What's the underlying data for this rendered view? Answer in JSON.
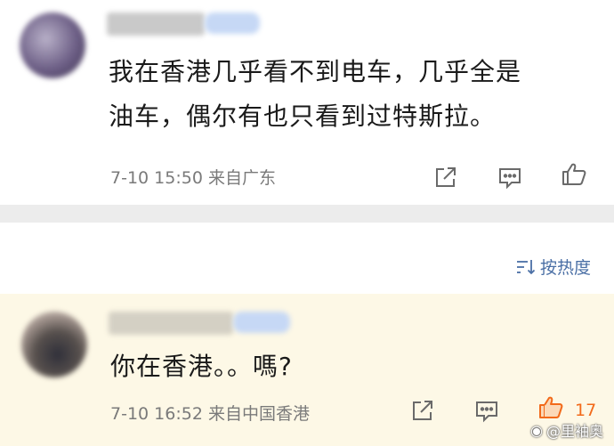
{
  "comments": [
    {
      "text_line1": "我在香港几乎看不到电车，几乎全是",
      "text_line2": "油车，偶尔有也只看到过特斯拉。",
      "time": "7-10  15:50  来自广东",
      "icons": [
        "share-icon",
        "comment-icon",
        "thumbs-up-icon"
      ]
    },
    {
      "text": "你在香港。。嗎?",
      "time": "7-10  16:52  来自中国香港",
      "likes": "17",
      "icons": [
        "share-icon",
        "comment-icon",
        "thumbs-up-icon"
      ]
    }
  ],
  "sort": {
    "label": "按热度",
    "icon": "sort-icon"
  },
  "watermark": {
    "text": "@里袖奥",
    "icon": "weibo-icon"
  },
  "colors": {
    "accent_link": "#4a6fa5",
    "liked": "#f26a1a",
    "highlight_bg": "#fdf8e6",
    "divider": "#ececec"
  }
}
